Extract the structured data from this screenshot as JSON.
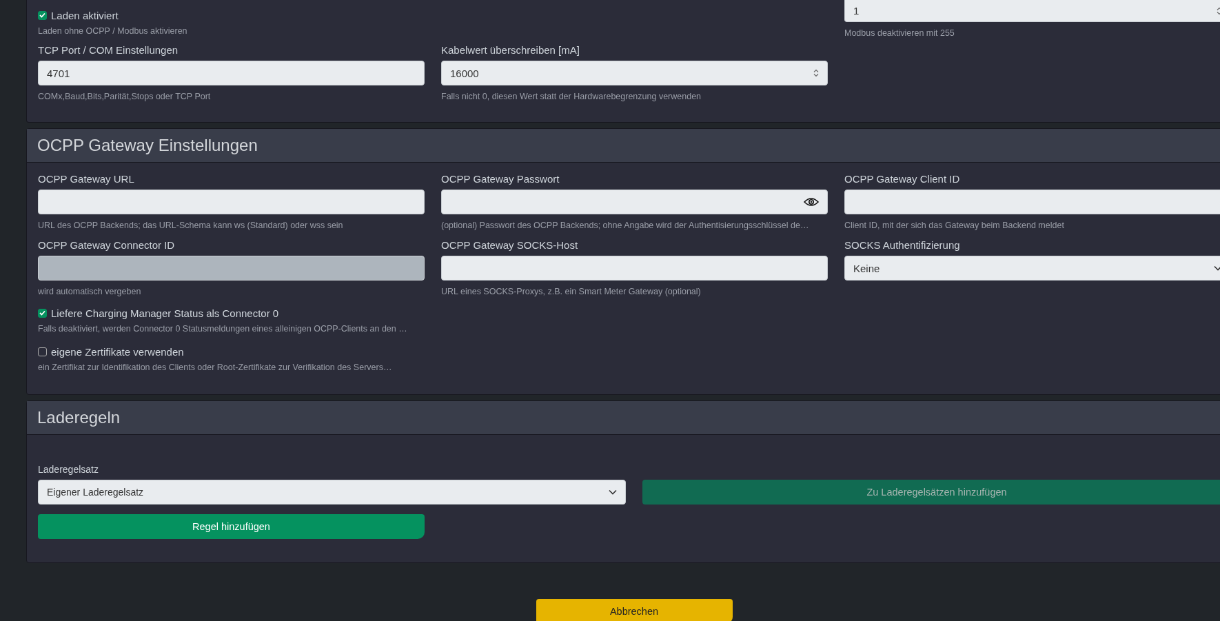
{
  "charging_card": {
    "enable_checkbox": {
      "label": "Laden aktiviert",
      "checked": true,
      "help": "Laden ohne OCPP / Modbus aktivieren"
    },
    "modbus_field": {
      "kind": "number",
      "value": "1",
      "help": "Modbus deaktivieren mit 255"
    },
    "fields": [
      {
        "label": "TCP Port / COM Einstellungen",
        "kind": "text",
        "value": "4701",
        "help": "COMx,Baud,Bits,Parität,Stops oder TCP Port",
        "disabled": false
      },
      {
        "label": "Kabelwert überschreiben [mA]",
        "kind": "number",
        "value": "16000",
        "help": "Falls nicht 0, diesen Wert statt der Hardwarebegrenzung verwenden",
        "disabled": false
      }
    ]
  },
  "ocpp_gateway": {
    "title": "OCPP Gateway Einstellungen",
    "fields": [
      {
        "label": "OCPP Gateway URL",
        "kind": "text",
        "help": "URL des OCPP Backends; das URL-Schema kann ws (Standard) oder wss sein",
        "disabled": false
      },
      {
        "label": "OCPP Gateway Passwort",
        "kind": "password",
        "help": "(optional) Passwort des OCPP Backends; ohne Angabe wird der Authentisierungsschlüssel de…",
        "disabled": false
      },
      {
        "label": "OCPP Gateway Client ID",
        "kind": "text",
        "help": "Client ID, mit der sich das Gateway beim Backend meldet",
        "disabled": false
      },
      {
        "label": "OCPP Gateway Connector ID",
        "kind": "text",
        "help": "wird automatisch vergeben",
        "disabled": true
      },
      {
        "label": "OCPP Gateway SOCKS-Host",
        "kind": "text",
        "help": "URL eines SOCKS-Proxys, z.B. ein Smart Meter Gateway (optional)",
        "disabled": false
      },
      {
        "label": "SOCKS Authentifizierung",
        "kind": "select",
        "value": "Keine",
        "disabled": false
      }
    ],
    "checkboxes": [
      {
        "label": "Liefere Charging Manager Status als Connector 0",
        "checked": true,
        "help": "Falls deaktiviert, werden Connector 0 Statusmeldungen eines alleinigen OCPP-Clients an den …"
      },
      {
        "label": "eigene Zertifikate verwenden",
        "checked": false,
        "help": "ein Zertifikat zur Identifikation des Clients oder Root-Zertifikate zur Verifikation des Servers…"
      }
    ]
  },
  "charging_rules": {
    "title": "Laderegeln",
    "ruleset": {
      "label": "Laderegelsatz",
      "value": "Eigener Laderegelsatz"
    },
    "add_to_rulesets_button": {
      "label": "Zu Laderegelsätzen hinzufügen",
      "disabled": true
    },
    "add_rule_button": {
      "label": "Regel hinzufügen"
    }
  },
  "cancel_button": {
    "label": "Abbrechen"
  }
}
